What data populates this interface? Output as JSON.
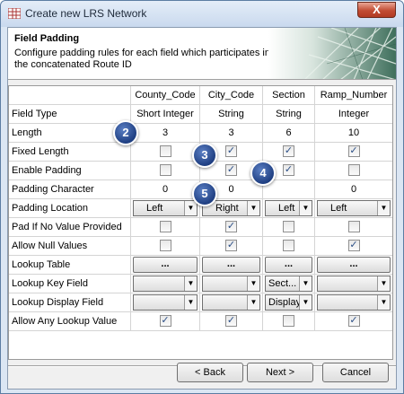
{
  "window": {
    "title": "Create new LRS Network",
    "close_label": "X"
  },
  "banner": {
    "title": "Field Padding",
    "description": "Configure padding rules for each field which participates in the concatenated Route ID"
  },
  "grid": {
    "columns": [
      "County_Code",
      "City_Code",
      "Section",
      "Ramp_Number"
    ],
    "rows": {
      "field_type": {
        "label": "Field Type",
        "values": [
          "Short Integer",
          "String",
          "String",
          "Integer"
        ]
      },
      "length": {
        "label": "Length",
        "values": [
          "3",
          "3",
          "6",
          "10"
        ]
      },
      "fixed_length": {
        "label": "Fixed Length",
        "checked": [
          false,
          true,
          true,
          true
        ]
      },
      "enable_padding": {
        "label": "Enable Padding",
        "checked": [
          false,
          true,
          true,
          false
        ]
      },
      "padding_character": {
        "label": "Padding Character",
        "values": [
          "0",
          "0",
          "",
          "0"
        ]
      },
      "padding_location": {
        "label": "Padding Location",
        "values": [
          "Left",
          "Right",
          "Left",
          "Left"
        ]
      },
      "pad_if_no_value": {
        "label": "Pad If No Value Provided",
        "checked": [
          false,
          true,
          false,
          false
        ]
      },
      "allow_null": {
        "label": "Allow Null Values",
        "checked": [
          false,
          true,
          false,
          true
        ]
      },
      "lookup_table": {
        "label": "Lookup Table",
        "button_label": "..."
      },
      "lookup_key_field": {
        "label": "Lookup Key Field",
        "values": [
          "",
          "",
          "Sect...",
          ""
        ]
      },
      "lookup_display_field": {
        "label": "Lookup Display Field",
        "values": [
          "",
          "",
          "Display",
          ""
        ]
      },
      "allow_any_lookup": {
        "label": "Allow Any Lookup Value",
        "checked": [
          true,
          true,
          false,
          true
        ]
      }
    }
  },
  "callouts": [
    "2",
    "3",
    "4",
    "5"
  ],
  "buttons": {
    "back": "< Back",
    "next": "Next >",
    "cancel": "Cancel"
  },
  "check_glyph": "✓",
  "arrow_glyph": "▼"
}
